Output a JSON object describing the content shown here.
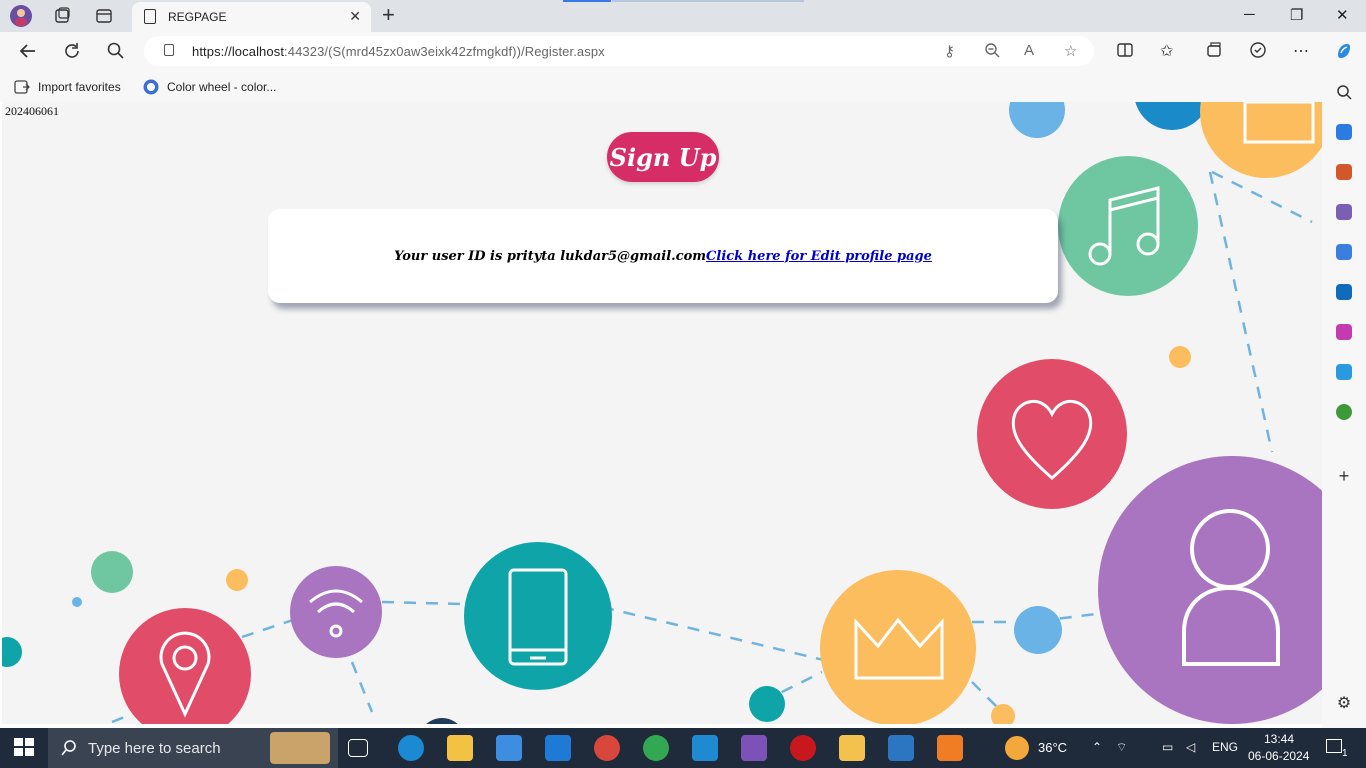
{
  "browser": {
    "tab_title": "REGPAGE",
    "tab_close": "✕",
    "new_tab": "+",
    "url_host": "https://localhost",
    "url_rest": ":44323/(S(mrd45zx0aw3eixk42zfmgkdf))/Register.aspx",
    "window_controls": [
      "─",
      "❐",
      "✕"
    ]
  },
  "favorites": [
    {
      "label": "Import favorites"
    },
    {
      "label": "Color wheel - color..."
    }
  ],
  "page": {
    "stamp": "202406061",
    "signup_label": "Sign Up",
    "user_id_text": "Your user ID is prityta lukdar5@gmail.com",
    "edit_link": "Click here for Edit profile page"
  },
  "taskbar": {
    "search_placeholder": "Type here to search",
    "weather": "36°C",
    "language": "ENG",
    "time": "13:44",
    "date": "06-06-2024",
    "notification_count": "1"
  },
  "colors": {
    "signup": "#d62d66",
    "link": "#0000cc"
  }
}
